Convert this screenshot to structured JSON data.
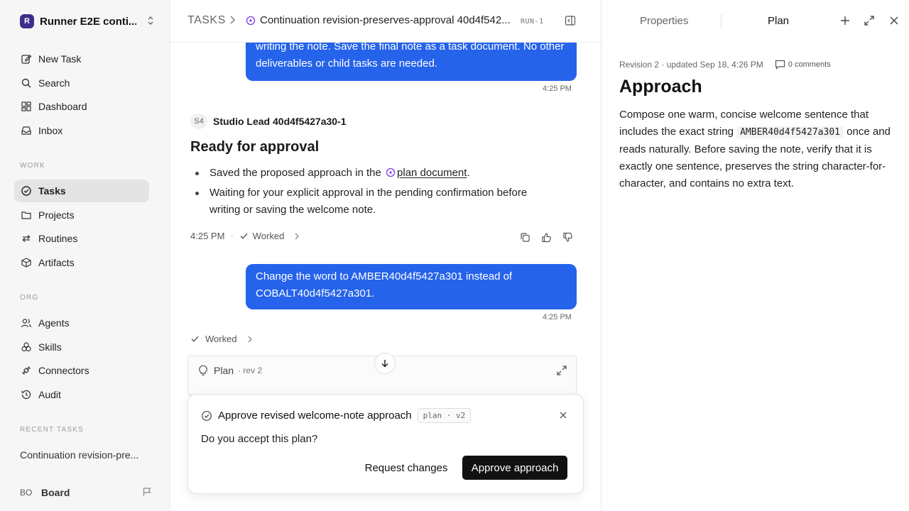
{
  "workspace": {
    "logo": "R",
    "name": "Runner E2E conti..."
  },
  "nav": [
    {
      "label": "New Task",
      "icon": "edit-icon"
    },
    {
      "label": "Search",
      "icon": "search-icon"
    },
    {
      "label": "Dashboard",
      "icon": "dashboard-icon"
    },
    {
      "label": "Inbox",
      "icon": "inbox-icon"
    }
  ],
  "sections": {
    "work": "WORK",
    "org": "ORG",
    "recent": "RECENT TASKS"
  },
  "work_nav": [
    {
      "label": "Tasks",
      "icon": "tasks-icon",
      "active": true
    },
    {
      "label": "Projects",
      "icon": "folder-icon"
    },
    {
      "label": "Routines",
      "icon": "routines-icon"
    },
    {
      "label": "Artifacts",
      "icon": "cube-icon"
    }
  ],
  "org_nav": [
    {
      "label": "Agents",
      "icon": "users-icon"
    },
    {
      "label": "Skills",
      "icon": "skills-icon"
    },
    {
      "label": "Connectors",
      "icon": "plug-icon"
    },
    {
      "label": "Audit",
      "icon": "history-icon"
    }
  ],
  "recent_task": "Continuation revision-pre...",
  "footer": {
    "initials": "BO",
    "name": "Board"
  },
  "header": {
    "root": "TASKS",
    "title": "Continuation revision-preserves-approval 40d4f542...",
    "run": "RUN-1"
  },
  "chat": {
    "user_msg_1": "writing the note. Save the final note as a task document. No other deliverables or child tasks are needed.",
    "time_1": "4:25 PM",
    "agent_badge": "S4",
    "agent_name": "Studio Lead 40d4f5427a30-1",
    "response_title": "Ready for approval",
    "bullet_1_pre": "Saved the proposed approach in the",
    "bullet_1_link": "plan document",
    "bullet_1_post": ".",
    "bullet_2": "Waiting for your explicit approval in the pending confirmation before writing or saving the welcome note.",
    "meta_time": "4:25 PM",
    "meta_dot": "·",
    "meta_worked": "Worked",
    "user_msg_2": "Change the word to AMBER40d4f5427a301 instead of COBALT40d4f5427a301.",
    "time_2": "4:25 PM",
    "worked_2": "Worked"
  },
  "plan_card": {
    "label": "Plan",
    "rev": "· rev 2"
  },
  "confirm": {
    "title": "Approve revised welcome-note approach",
    "chip": "plan · v2",
    "question": "Do you accept this plan?",
    "secondary": "Request changes",
    "primary": "Approve approach"
  },
  "panel": {
    "tab_properties": "Properties",
    "tab_plan": "Plan",
    "revision": "Revision 2 · updated Sep 18, 4:26 PM",
    "comments": "0 comments",
    "title": "Approach",
    "body_1": "Compose one warm, concise welcome sentence that includes the exact string",
    "body_code": "AMBER40d4f5427a301",
    "body_2": "once and reads naturally. Before saving the note, verify that it is exactly one sentence, preserves the string character-for-character, and contains no extra text."
  },
  "colors": {
    "accent": "#2563eb",
    "primary_button": "#111111",
    "sidebar_bg": "#f6f6f6",
    "status_icon": "#7c3aed"
  }
}
